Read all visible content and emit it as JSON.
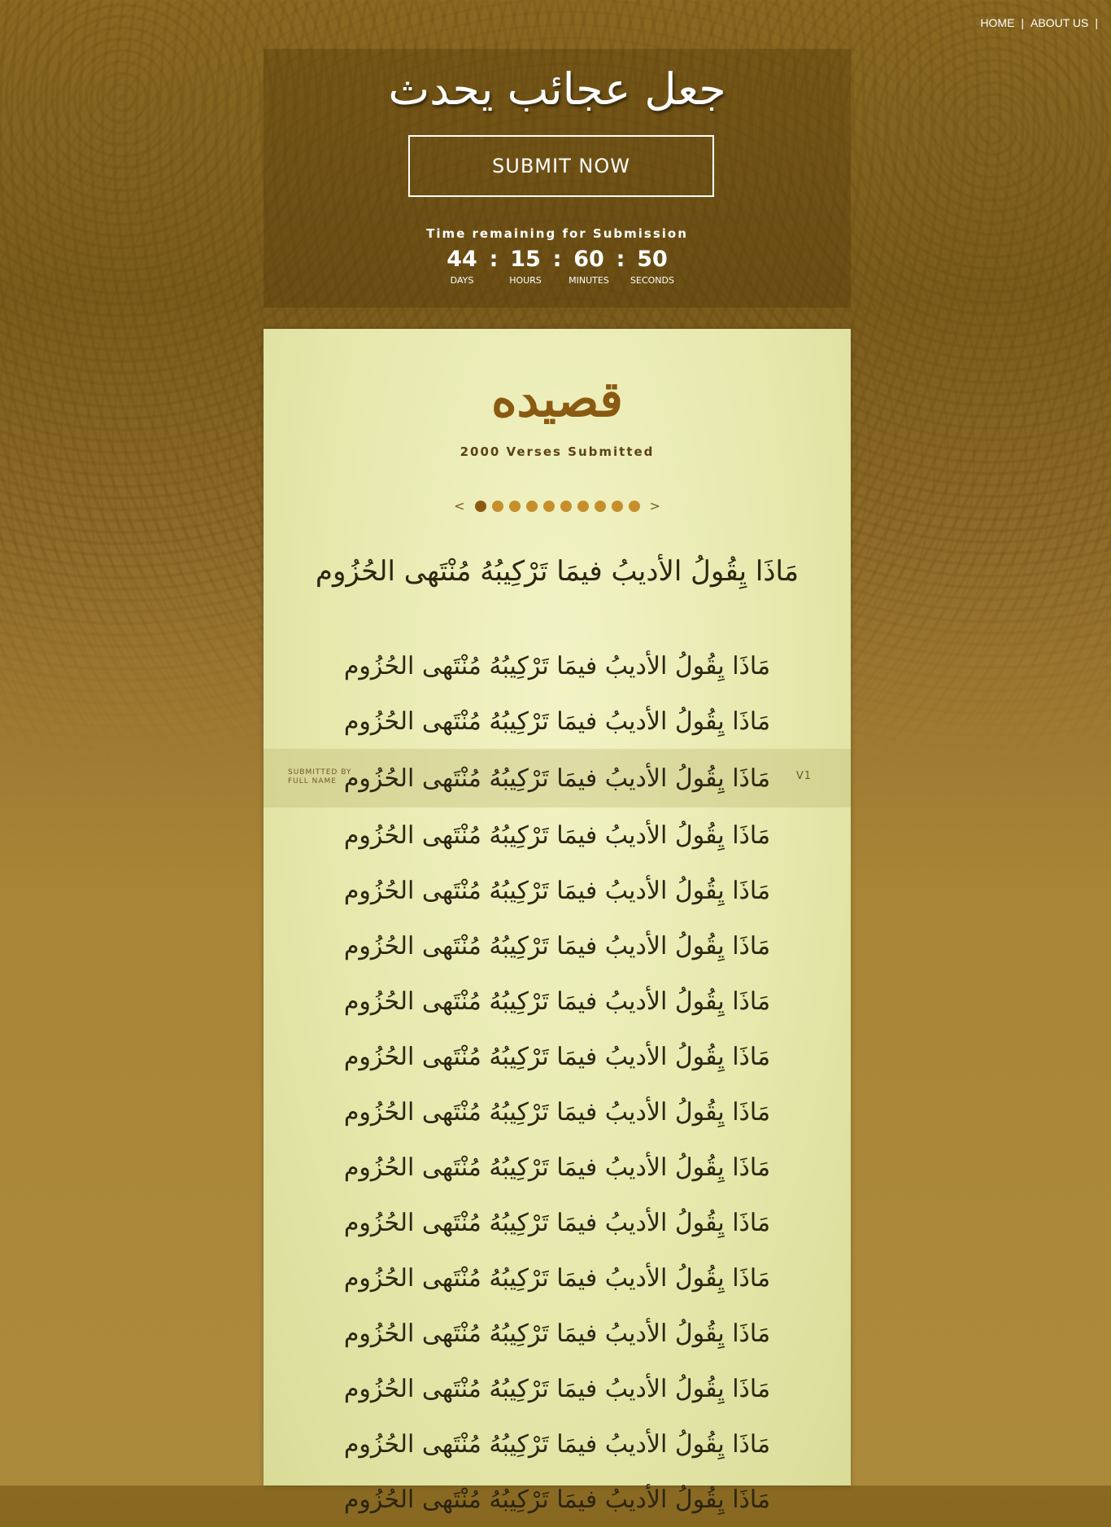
{
  "nav": {
    "items": [
      "HOME",
      "ABOUT US"
    ],
    "separator": "|"
  },
  "hero": {
    "title": "جعل عجائب يحدث",
    "submit_label": "SUBMIT NOW",
    "countdown_caption": "Time remaining for Submission",
    "countdown": {
      "days": "44",
      "hours": "15",
      "minutes": "60",
      "seconds": "50",
      "days_label": "DAYS",
      "hours_label": "HOURS",
      "minutes_label": "MINUTES",
      "seconds_label": "SECONDS",
      "separator": ":"
    }
  },
  "card": {
    "title": "قصيده",
    "verses_count": "2000 Verses Submitted",
    "pager": {
      "prev": "<",
      "next": ">",
      "dot_count": 10,
      "active_index": 0
    },
    "featured_verse": "مَاذَا يِقُولُ الأديبُ فيمَا   تَرْكِيبُهُ مُنْتَهى الحُزُوم",
    "verse_text": "مَاذَا يِقُولُ الأديبُ فيمَا   تَرْكِيبُهُ مُنْتَهى الحُزُوم",
    "highlighted": {
      "submitted_by_line1": "SUBMITTED BY",
      "submitted_by_line2": "FULL NAME",
      "tag": "V1"
    }
  },
  "colors": {
    "accent_brown": "#8a5a12",
    "dot_gold": "#c58f2b",
    "paper": "#e6e8ad"
  }
}
